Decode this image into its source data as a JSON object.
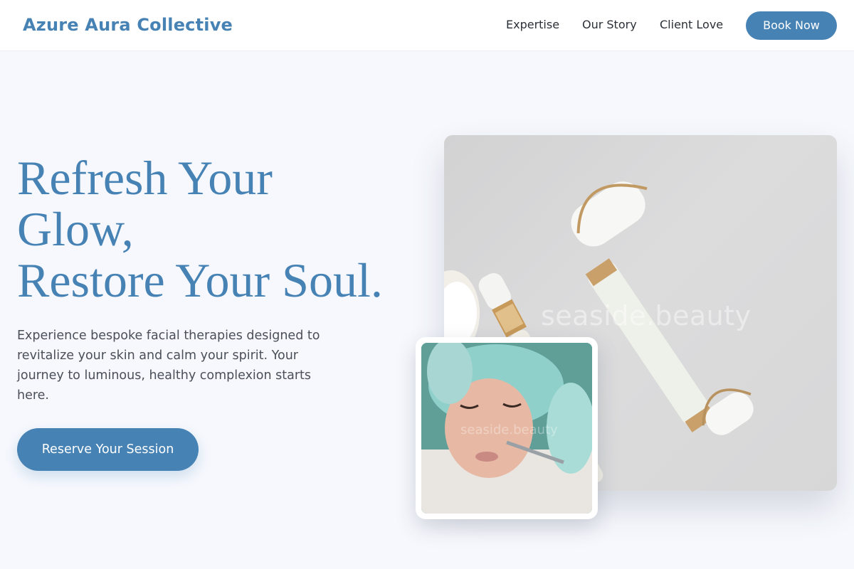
{
  "header": {
    "brand": "Azure Aura Collective",
    "nav": [
      "Expertise",
      "Our Story",
      "Client Love"
    ],
    "cta": "Book Now"
  },
  "hero": {
    "title_lines": [
      "Refresh Your",
      "Glow,",
      "Restore Your Soul."
    ],
    "description": "Experience bespoke facial therapies designed to revitalize your skin and calm your spirit. Your journey to luminous, healthy complexion starts here.",
    "cta": "Reserve Your Session"
  },
  "images": {
    "main_watermark": "seaside.beauty",
    "sub_watermark": "seaside.beauty"
  },
  "colors": {
    "accent": "#4682b4",
    "background": "#f6f8fd"
  }
}
